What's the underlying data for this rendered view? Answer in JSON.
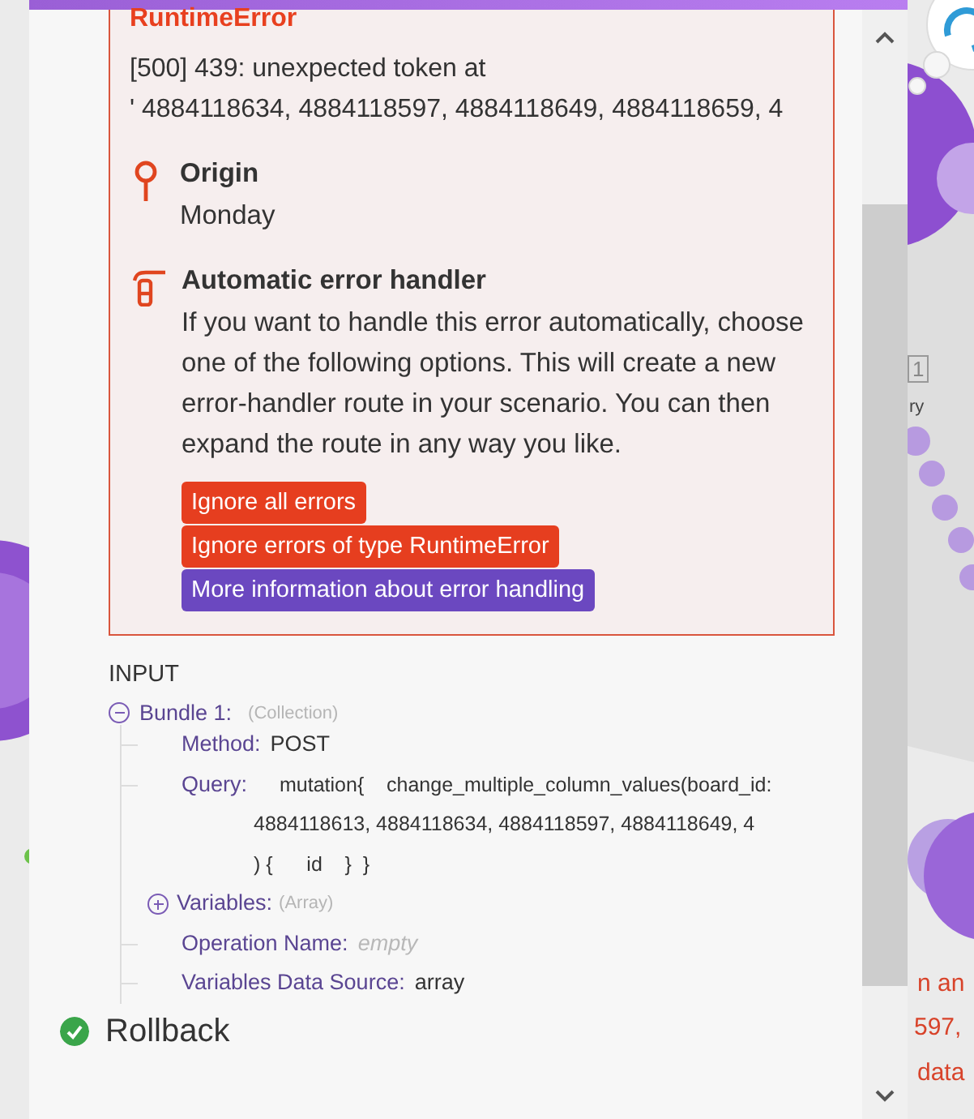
{
  "error": {
    "type": "RuntimeError",
    "message_lines": [
      "[500] 439: unexpected token at",
      "' 4884118634, 4884118597, 4884118649, 4884118659, 4"
    ],
    "sections": [
      {
        "kind": "origin",
        "title": "Origin",
        "text": "Monday"
      },
      {
        "kind": "handler",
        "title": "Automatic error handler",
        "text": "If you want to handle this error automatically, choose one of the following options. This will create a new error-handler route in your scenario. You can then expand the route in any way you like.",
        "buttons": [
          {
            "label": "Ignore all errors",
            "kind": "danger"
          },
          {
            "label": "Ignore errors of type RuntimeError",
            "kind": "danger"
          },
          {
            "label": "More information about error handling",
            "kind": "info"
          }
        ]
      }
    ]
  },
  "input": {
    "heading": "INPUT",
    "tree": [
      {
        "label": "Bundle 1:",
        "type": "(Collection)",
        "expanded": true,
        "children": [
          {
            "label": "Method:",
            "value": "POST"
          },
          {
            "label": "Query:",
            "value_lines": [
              "mutation{    change_multiple_column_values(board_id:",
              "4884118613, 4884118634, 4884118597, 4884118649, 4",
              ") {      id    }  }"
            ]
          },
          {
            "label": "Variables:",
            "type": "(Array)",
            "expanded": false
          },
          {
            "label": "Operation Name:",
            "value": "empty",
            "empty": true
          },
          {
            "label": "Variables Data Source:",
            "value": "array"
          }
        ]
      }
    ]
  },
  "next_item": {
    "label": "Rollback"
  },
  "canvas": {
    "texts": [
      {
        "text": "1",
        "color": "#888888"
      },
      {
        "text": "ry",
        "color": "#444444"
      },
      {
        "text": "n an",
        "color": "#d8432a"
      },
      {
        "text": "597,",
        "color": "#d8432a"
      },
      {
        "text": "data",
        "color": "#d8432a"
      }
    ]
  }
}
